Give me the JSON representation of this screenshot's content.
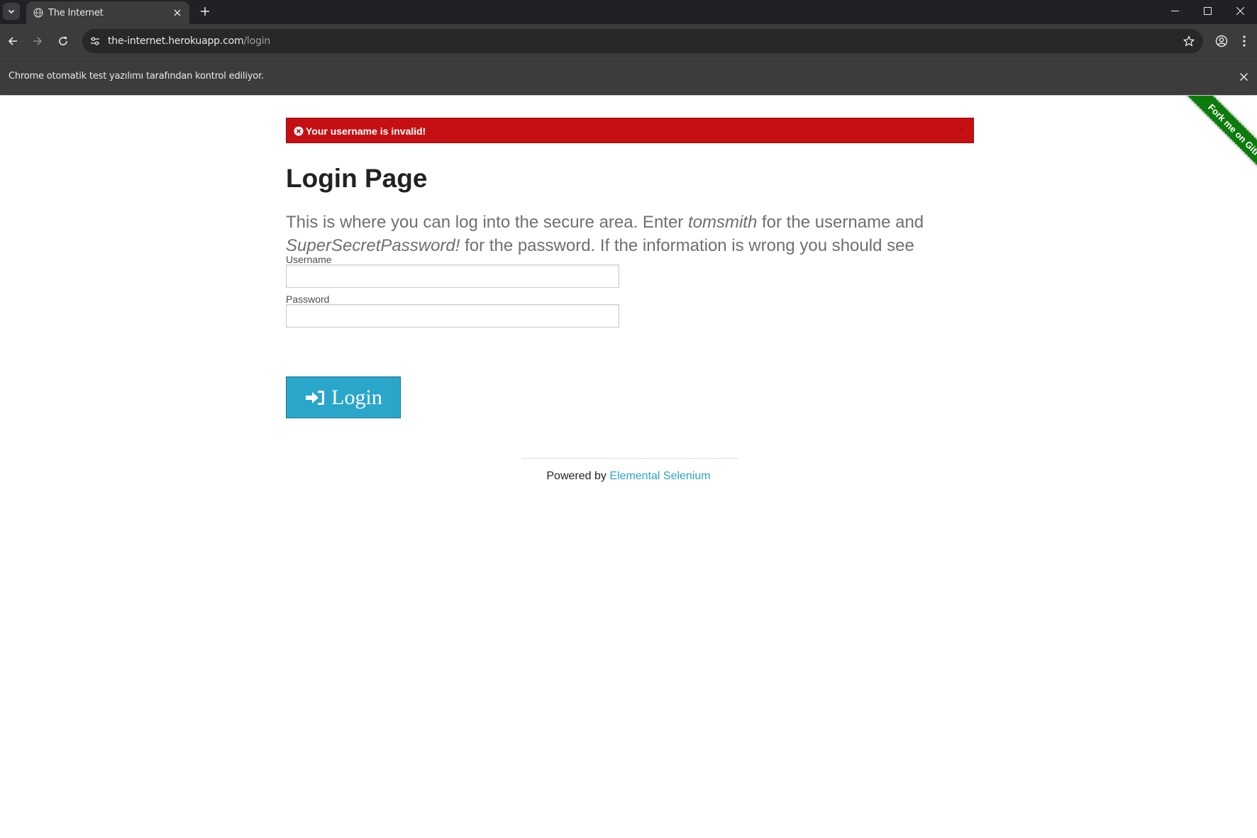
{
  "browser": {
    "tab": {
      "title": "The Internet"
    },
    "address_bar": {
      "host": "the-internet.herokuapp.com",
      "path": "/login"
    },
    "infobar": {
      "message": "Chrome otomatik test yazılımı tarafından kontrol ediliyor."
    },
    "icons": [
      "tab-search-icon",
      "globe-icon",
      "close-icon",
      "plus-icon",
      "minimize-icon",
      "maximize-icon",
      "close-window-icon",
      "back-arrow-icon",
      "forward-arrow-icon",
      "reload-icon",
      "site-settings-icon",
      "star-icon",
      "profile-icon",
      "kebab-menu-icon"
    ]
  },
  "page": {
    "ribbon": {
      "text": "Fork me on GitHub",
      "color": "#0c7b0c"
    },
    "flash": {
      "message": "Your username is invalid!",
      "close_label": "×",
      "color": "#c60f13"
    },
    "title": "Login Page",
    "intro": {
      "part1": "This is where you can log into the secure area. Enter ",
      "username_hint": "tomsmith",
      "part2": " for the username and ",
      "password_hint": "SuperSecretPassword!",
      "part3": " for the password. If the information is wrong you should see error messages."
    },
    "form": {
      "username_label": "Username",
      "username_value": "",
      "password_label": "Password",
      "password_value": "",
      "login_label": "Login",
      "button_color": "#2ba6cb"
    },
    "footer": {
      "powered_by": "Powered by ",
      "link_text": "Elemental Selenium",
      "link_color": "#2ba6cb"
    }
  }
}
